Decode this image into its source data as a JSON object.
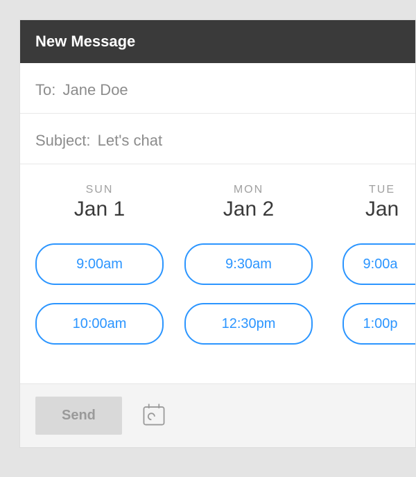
{
  "header": {
    "title": "New Message"
  },
  "to": {
    "label": "To:",
    "value": "Jane Doe"
  },
  "subject": {
    "label": "Subject:",
    "value": "Let's chat"
  },
  "schedule": {
    "days": [
      {
        "weekday": "SUN",
        "date": "Jan 1",
        "slots": [
          "9:00am",
          "10:00am"
        ]
      },
      {
        "weekday": "MON",
        "date": "Jan 2",
        "slots": [
          "9:30am",
          "12:30pm"
        ]
      },
      {
        "weekday": "TUE",
        "date": "Jan",
        "slots": [
          "9:00a",
          "1:00p"
        ]
      }
    ]
  },
  "footer": {
    "send_label": "Send"
  },
  "colors": {
    "accent": "#2b95ff",
    "header_bg": "#3a3a3a"
  }
}
